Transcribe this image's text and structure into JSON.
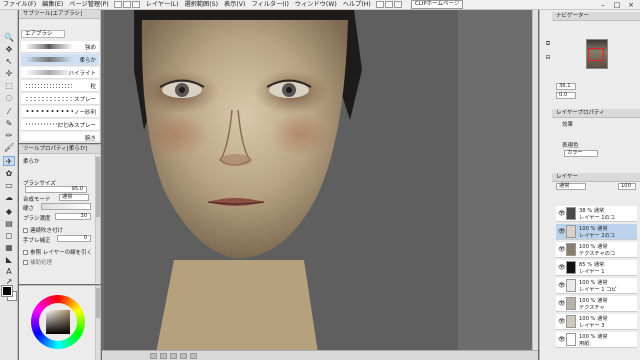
{
  "menu": {
    "items": [
      "ファイル(F)",
      "編集(E)",
      "ページ管理(P)",
      "アニメーション(A)",
      "レイヤー(L)",
      "選択範囲(S)",
      "表示(V)",
      "フィルター(I)",
      "ウィンドウ(W)",
      "ヘルプ(H)"
    ],
    "clip_link": "CLIPホームページ",
    "win_min": "–",
    "win_max": "□",
    "win_close": "×"
  },
  "subtool": {
    "title": "サブツール[エアブラシ]",
    "group": "エアブラシ",
    "brushes": [
      {
        "label": "強め"
      },
      {
        "label": "柔らか"
      },
      {
        "label": "ハイライト"
      },
      {
        "label": "粒"
      },
      {
        "label": "スプレー"
      },
      {
        "label": "ノー砂利"
      },
      {
        "label": "にじみスプレー"
      },
      {
        "label": "腕き"
      }
    ]
  },
  "toolprop": {
    "title": "ツールプロパティ[柔らか]",
    "name": "柔らか",
    "brush_size_label": "ブラシサイズ",
    "brush_size_value": "95.0",
    "blend_label": "合成モード",
    "blend_value": "通常",
    "hardness_label": "硬さ",
    "density_label": "ブラシ濃度",
    "density_value": "30",
    "continuous_label": "連続吹き付け",
    "stabilization_label": "手ブレ補正",
    "stabilization_value": "0",
    "ref_layer_label": "参照 レイヤーの線を引く",
    "aux_label": "補助処理"
  },
  "rightpanel": {
    "navigator_title": "ナビゲーター",
    "zoom_value": "36.1",
    "rotate_value": "0.0",
    "layerprop_title": "レイヤープロパティ",
    "effect_label": "効果",
    "expression_label": "表現色",
    "expression_value": "カラー",
    "layer_title": "レイヤー",
    "blend_value": "通常",
    "opacity_value": "100"
  },
  "layers": [
    {
      "line1": "38 % 通常",
      "line2": "レイヤー 1のコ",
      "thumb": "#4a4a4a",
      "sel": false
    },
    {
      "line1": "100 % 通常",
      "line2": "レイヤー 2のコ",
      "thumb": "#d8d2c8",
      "sel": true
    },
    {
      "line1": "100 % 通常",
      "line2": "テクスチャのコ",
      "thumb": "#8a7d6c",
      "sel": false
    },
    {
      "line1": "85 % 通常",
      "line2": "レイヤー 1",
      "thumb": "#111111",
      "sel": false
    },
    {
      "line1": "100 % 通常",
      "line2": "レイヤー 1 コピ",
      "thumb": "#e8e8e8",
      "sel": false
    },
    {
      "line1": "100 % 通常",
      "line2": "テクスチャ",
      "thumb": "#b9b2a6",
      "sel": false
    },
    {
      "line1": "100 % 通常",
      "line2": "レイヤー 3",
      "thumb": "#cfc9bd",
      "sel": false
    },
    {
      "line1": "100 % 通常",
      "line2": "用紙",
      "thumb": "#ffffff",
      "sel": false
    }
  ],
  "colors": {
    "skin": "#cdb99a",
    "canvas_bg": "#5d5d5d",
    "accent": "#7ea6d2"
  }
}
